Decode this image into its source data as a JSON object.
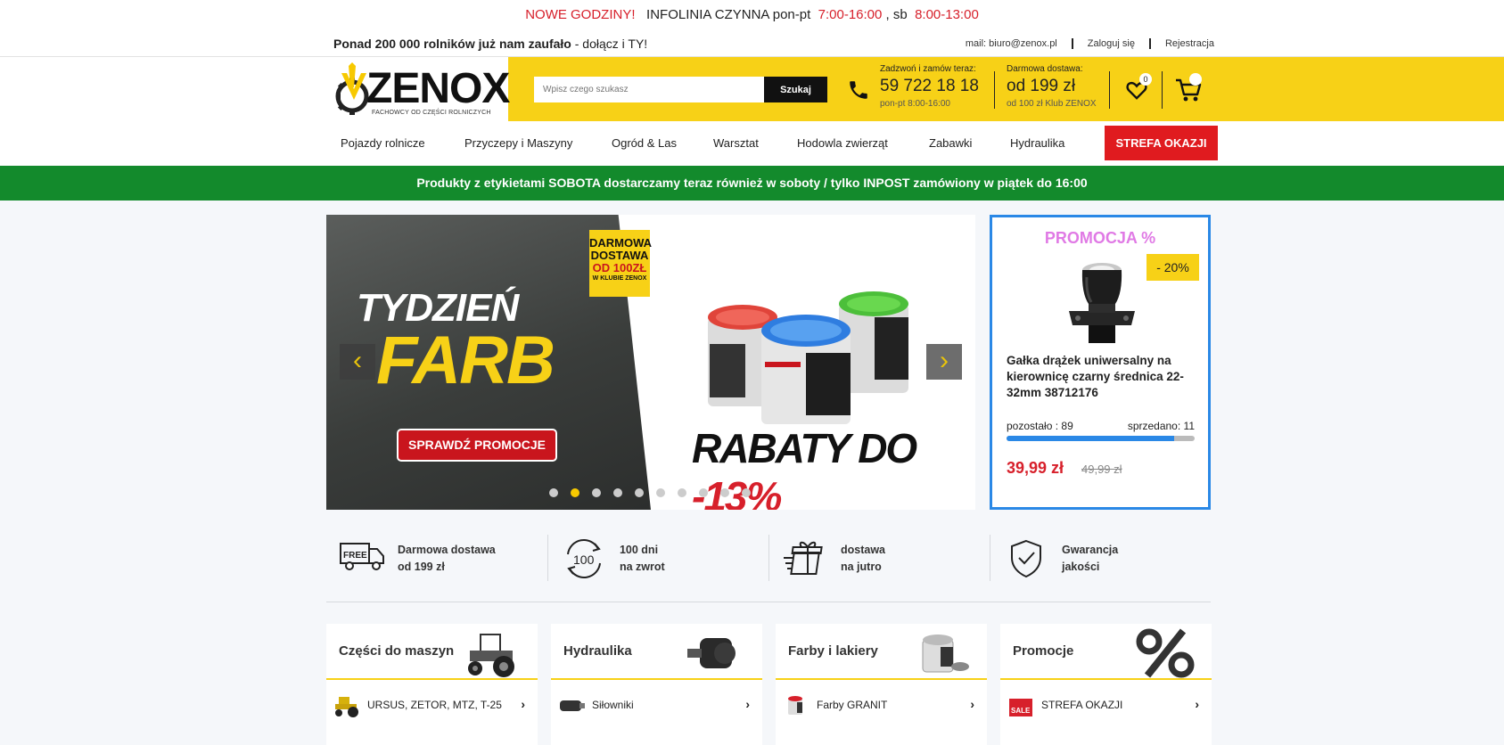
{
  "topbar": {
    "new_hours": "NOWE GODZINY!",
    "hotline": "INFOLINIA CZYNNA pon-pt",
    "weekday_hours": "7:00-16:00",
    "sat_label": ", sb",
    "sat_hours": "8:00-13:00"
  },
  "subbar": {
    "trust_bold": "Ponad 200 000 rolników już nam zaufało",
    "trust_rest": " - dołącz i TY!",
    "mail": "mail: biuro@zenox.pl",
    "login": "Zaloguj się",
    "register": "Rejestracja"
  },
  "header": {
    "logo_word": "ZENOX",
    "logo_tagline": "FACHOWCY OD CZĘŚCI ROLNICZYCH",
    "search_placeholder": "Wpisz czego szukasz",
    "search_button": "Szukaj",
    "call_label": "Zadzwoń i zamów teraz:",
    "phone_number": "59 722 18 18",
    "phone_hours": "pon-pt 8:00-16:00",
    "delivery_label": "Darmowa dostawa:",
    "delivery_value": "od 199 zł",
    "delivery_club": "od 100 zł Klub ZENOX",
    "wishlist_count": "0"
  },
  "nav": {
    "items": [
      "Pojazdy rolnicze",
      "Przyczepy i Maszyny",
      "Ogród & Las",
      "Warsztat",
      "Hodowla zwierząt",
      "Zabawki",
      "Hydraulika"
    ],
    "deal_button": "STREFA OKAZJI"
  },
  "announcement": "Produkty z etykietami SOBOTA dostarczamy teraz również w soboty / tylko INPOST zamówiony w piątek do 16:00",
  "hero": {
    "line1": "TYDZIEŃ",
    "line2": "FARB",
    "cta": "SPRAWDŹ PROMOCJE",
    "free_l1": "DARMOWA",
    "free_l2": "DOSTAWA",
    "free_l3": "OD 100ZŁ",
    "free_l4": "W KLUBIE ZENOX",
    "discount_text": "RABATY DO ",
    "discount_pct": "-13%",
    "slide_count": 10,
    "active_slide": 1,
    "prev_icon": "chevron-left-icon",
    "next_icon": "chevron-right-icon"
  },
  "promo": {
    "title": "PROMOCJA %",
    "discount": "- 20%",
    "product_name": "Gałka drążek uniwersalny na kierownicę czarny średnica 22-32mm 38712176",
    "left_label": "pozostało :",
    "left_value": "89",
    "sold_label": "sprzedano:",
    "sold_value": "11",
    "stock_fraction": 0.89,
    "price": "39,99 zł",
    "old_price": "49,99 zł"
  },
  "features": [
    {
      "icon": "free-truck-icon",
      "line1": "Darmowa dostawa",
      "line2": "od 199 zł"
    },
    {
      "icon": "return-100-icon",
      "line1": "100 dni",
      "line2": "na zwrot"
    },
    {
      "icon": "gift-delivery-icon",
      "line1": "dostawa",
      "line2": "na jutro"
    },
    {
      "icon": "shield-check-icon",
      "line1": "Gwarancja",
      "line2": "jakości"
    }
  ],
  "categories": [
    {
      "title": "Części do maszyn",
      "icon": "tractor-icon",
      "first_item": "URSUS, ZETOR, MTZ, T-25"
    },
    {
      "title": "Hydraulika",
      "icon": "hydraulic-motor-icon",
      "first_item": "Siłowniki"
    },
    {
      "title": "Farby i lakiery",
      "icon": "paint-can-icon",
      "first_item": "Farby GRANIT"
    },
    {
      "title": "Promocje",
      "icon": "percent-icon",
      "first_item": "STREFA OKAZJI"
    }
  ],
  "colors": {
    "brand_yellow": "#f7d117",
    "alert_red": "#d7202b",
    "green_bar": "#138a2c",
    "promo_blue": "#2a88e6",
    "promo_title": "#e07ae5"
  }
}
